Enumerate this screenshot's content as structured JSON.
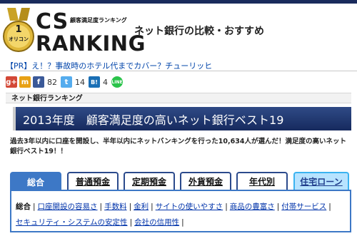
{
  "header": {
    "logo_cs": "CS",
    "logo_ranking": "RANKING",
    "logo_subtitle": "顧客満足度ランキング",
    "medal_text": "オリコン",
    "medal_number": "1",
    "tagline": "ネット銀行の比較・おすすめ"
  },
  "promo": {
    "text": "【PR】え！？事故時のホテル代までカバー？チューリッヒ"
  },
  "share": {
    "items": [
      {
        "icon": "google-plus-icon",
        "label": "g+",
        "color": "#d34836",
        "count": ""
      },
      {
        "icon": "mixi-icon",
        "label": "m",
        "color": "#e8a114",
        "count": ""
      },
      {
        "icon": "facebook-icon",
        "label": "f",
        "color": "#3b5998",
        "count": "82"
      },
      {
        "icon": "twitter-icon",
        "label": "t",
        "color": "#55acee",
        "count": "14"
      },
      {
        "icon": "hatena-bookmark-icon",
        "label": "B!",
        "color": "#1a6fb5",
        "count": "4"
      },
      {
        "icon": "line-icon",
        "label": "LINE",
        "color": "#2ac34a",
        "count": ""
      }
    ]
  },
  "section": {
    "label": "ネット銀行ランキング"
  },
  "title": {
    "text": "2013年度　顧客満足度の高いネット銀行ベスト19"
  },
  "description": {
    "text": "過去3年以内に口座を開設し、半年以内にネットバンキングを行った10,634人が選んだ！満足度の高いネット銀行ベスト19！！"
  },
  "tabs": [
    {
      "label": "総合",
      "active": true
    },
    {
      "label": "普通預金",
      "active": false
    },
    {
      "label": "定期預金",
      "active": false
    },
    {
      "label": "外貨預金",
      "active": false
    },
    {
      "label": "年代別",
      "active": false
    },
    {
      "label": "住宅ローン",
      "active": false
    }
  ],
  "categories": {
    "row1": [
      "総合",
      "口座開設の容易さ",
      "手数料",
      "金利",
      "サイトの使いやすさ",
      "商品の豊富さ",
      "付帯サービス"
    ],
    "row2": [
      "セキュリティ・システムの安定性",
      "会社の信用性"
    ]
  },
  "colors": {
    "navy": "#1a2b5c",
    "tab_active": "#3d78c6",
    "link": "#0033aa",
    "loan_tab_bg": "#b7e3ff"
  }
}
